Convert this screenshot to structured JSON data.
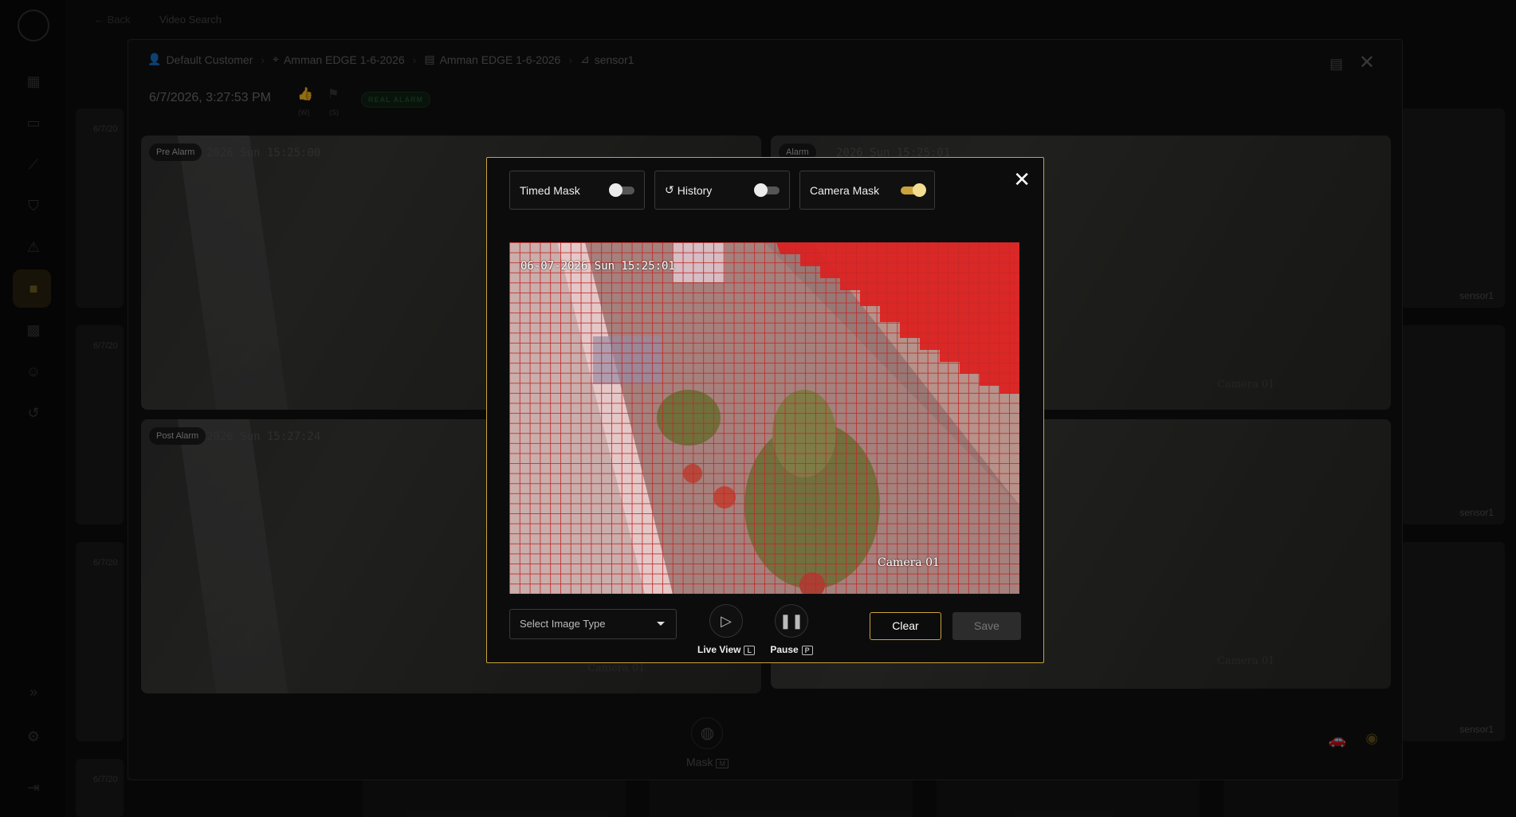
{
  "topbar": {
    "back_label": "Back",
    "title": "Video Search"
  },
  "dialog": {
    "breadcrumb": [
      "Default Customer",
      "Amman EDGE 1-6-2026",
      "Amman EDGE 1-6-2026",
      "sensor1"
    ],
    "timestamp": "6/7/2026, 3:27:53 PM",
    "badge": "REAL ALARM",
    "thumb_up_key": "(W)",
    "flag_key": "(S)",
    "frames": {
      "pre_alarm": {
        "label": "Pre Alarm",
        "stamp": "2026 Sun 15:25:00"
      },
      "alarm": {
        "label": "Alarm",
        "stamp": "2026 Sun 15:25:01",
        "camera": "Camera 01"
      },
      "post_alarm": {
        "label": "Post Alarm",
        "stamp": "2026 Sun 15:27:24",
        "camera": "Camera 01"
      },
      "fourth": {
        "camera": "Camera 01"
      }
    },
    "mask_label": "Mask",
    "mask_key": "M"
  },
  "mask_modal": {
    "timed_mask": {
      "label": "Timed Mask",
      "on": false
    },
    "history": {
      "label": "History",
      "on": false
    },
    "camera_mask": {
      "label": "Camera Mask",
      "on": true
    },
    "camera_stamp": "06-07-2026 Sun 15:25:01",
    "camera_name": "Camera 01",
    "select_placeholder": "Select Image Type",
    "live_view_label": "Live View",
    "live_view_key": "L",
    "pause_label": "Pause",
    "pause_key": "P",
    "clear_label": "Clear",
    "save_label": "Save"
  },
  "sensor_labels": [
    "sensor1",
    "sensor1",
    "sensor1"
  ],
  "dates": [
    "6/7/20",
    "6/7/20",
    "6/7/20",
    "6/7/20"
  ],
  "colors": {
    "accent": "#c9a23c",
    "mask_red": "#e01818"
  }
}
